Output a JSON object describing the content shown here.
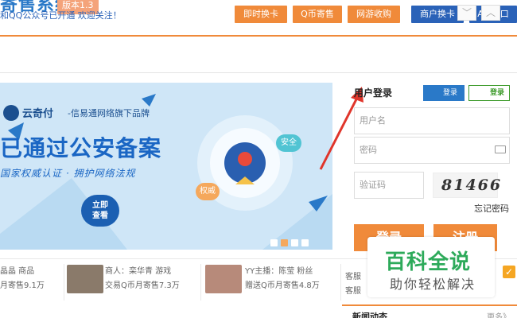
{
  "header": {
    "site_title": "寄售系统",
    "version": "版本1.3",
    "nav": [
      "即时换卡",
      "Q币寄售",
      "网游收购",
      "商户换卡",
      "API接口"
    ]
  },
  "notice": {
    "text": "和QQ公众号已开通 欢迎关注！",
    "prev_label": "﹀",
    "next_label": "︿"
  },
  "banner": {
    "brand": "云奇付",
    "tagline": "-信易通网络旗下品牌",
    "headline": "已通过公安备案",
    "subline": "国家权威认证 · 拥护网络法规",
    "badge_safe": "安全",
    "badge_auth": "权威",
    "view_button": [
      "立即",
      "查看"
    ],
    "active_dot": 2
  },
  "login": {
    "title": "用户登录",
    "qq_label": "登录",
    "wechat_label": "登录",
    "username_placeholder": "用户名",
    "password_placeholder": "密码",
    "captcha_placeholder": "验证码",
    "captcha_text": "81466",
    "forgot": "忘记密码",
    "login_button": "登录",
    "register_button": "注册"
  },
  "feed": [
    {
      "line1": "晶晶 商品",
      "line2": "月寄售9.1万"
    },
    {
      "line1": "商人：栾华青 游戏",
      "line2": "交易Q币月寄售7.3万"
    },
    {
      "line1": "YY主播：陈莹 粉丝",
      "line2": "赠送Q币月寄售4.8万"
    },
    {
      "line1": "客服",
      "line2": "客服"
    }
  ],
  "news": {
    "title": "新闻动态",
    "more": "更多》"
  },
  "watermark": {
    "main": "百科全说",
    "sub": "助你轻松解决"
  },
  "colors": {
    "accent_orange": "#f08a3a",
    "accent_blue": "#2a62b8",
    "banner_bg": "#cfe6f7"
  }
}
